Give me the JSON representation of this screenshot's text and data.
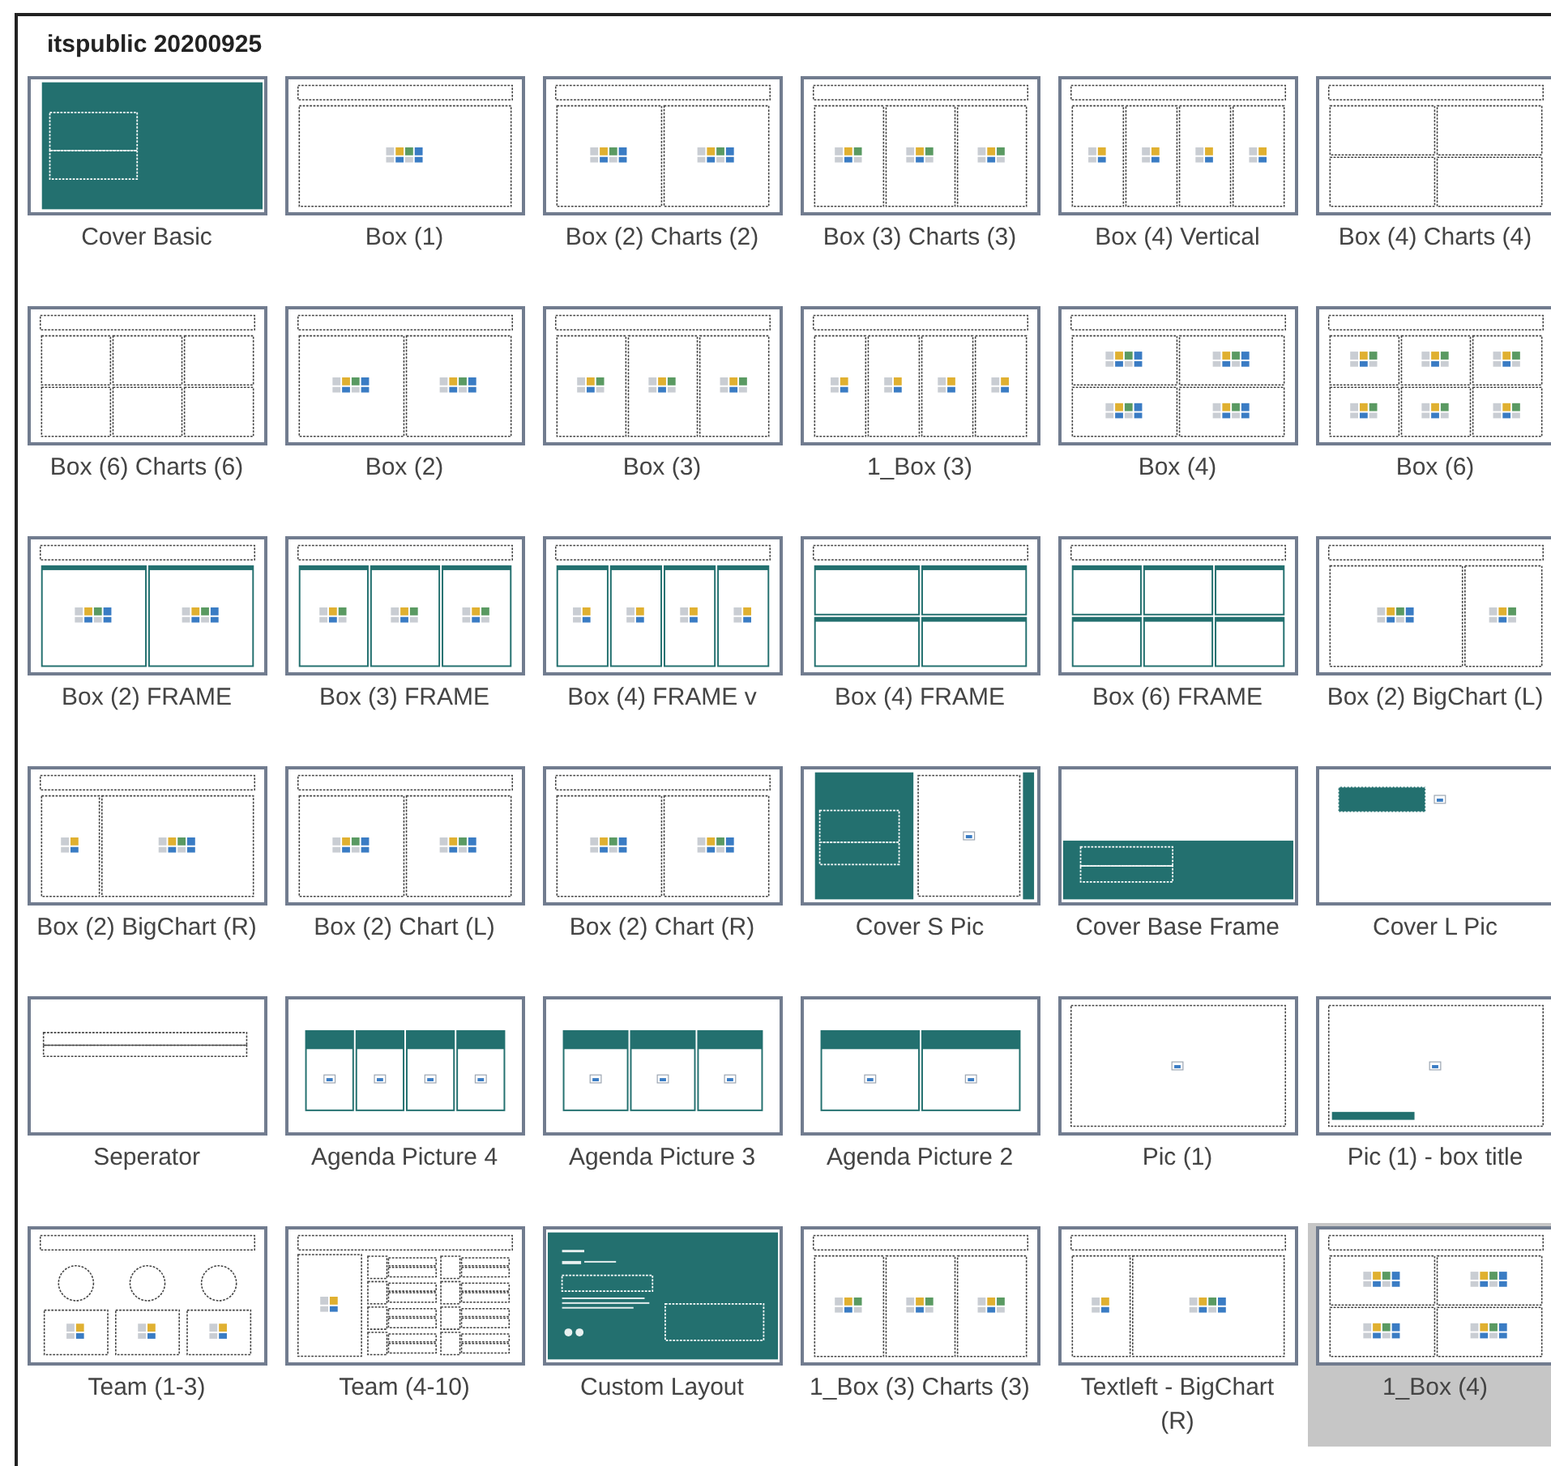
{
  "gallery": {
    "title": "itspublic 20200925"
  },
  "layouts": [
    {
      "label": "Cover Basic",
      "selected": false,
      "kind": "cover"
    },
    {
      "label": "Box (1)",
      "selected": false,
      "kind": "box1"
    },
    {
      "label": "Box (2) Charts (2)",
      "selected": false,
      "kind": "box2"
    },
    {
      "label": "Box (3) Charts (3)",
      "selected": false,
      "kind": "box3"
    },
    {
      "label": "Box (4) Vertical",
      "selected": false,
      "kind": "box4"
    },
    {
      "label": "Box (4) Charts (4)",
      "selected": false,
      "kind": "empty4"
    },
    {
      "label": "Box (6) Charts (6)",
      "selected": false,
      "kind": "empty6"
    },
    {
      "label": "Box (2)",
      "selected": false,
      "kind": "box2"
    },
    {
      "label": "Box (3)",
      "selected": false,
      "kind": "box3"
    },
    {
      "label": "1_Box (3)",
      "selected": false,
      "kind": "box4"
    },
    {
      "label": "Box (4)",
      "selected": false,
      "kind": "quad"
    },
    {
      "label": "Box (6)",
      "selected": false,
      "kind": "six"
    },
    {
      "label": "Box (2) FRAME",
      "selected": false,
      "kind": "frame2"
    },
    {
      "label": "Box (3) FRAME",
      "selected": false,
      "kind": "frame3"
    },
    {
      "label": "Box (4) FRAME v",
      "selected": false,
      "kind": "frame4"
    },
    {
      "label": "Box (4) FRAME",
      "selected": false,
      "kind": "framequad"
    },
    {
      "label": "Box (6) FRAME",
      "selected": false,
      "kind": "framesix"
    },
    {
      "label": "Box (2) BigChart (L)",
      "selected": false,
      "kind": "bigleft"
    },
    {
      "label": "Box (2) BigChart (R)",
      "selected": false,
      "kind": "bigright"
    },
    {
      "label": "Box (2) Chart (L)",
      "selected": false,
      "kind": "box2"
    },
    {
      "label": "Box (2) Chart (R)",
      "selected": false,
      "kind": "box2"
    },
    {
      "label": "Cover S Pic",
      "selected": false,
      "kind": "coverspic"
    },
    {
      "label": "Cover Base Frame",
      "selected": false,
      "kind": "coverframe"
    },
    {
      "label": "Cover L Pic",
      "selected": false,
      "kind": "coverlpic"
    },
    {
      "label": "Seperator",
      "selected": false,
      "kind": "separator"
    },
    {
      "label": "Agenda Picture 4",
      "selected": false,
      "kind": "agenda4"
    },
    {
      "label": "Agenda Picture 3",
      "selected": false,
      "kind": "agenda3"
    },
    {
      "label": "Agenda Picture 2",
      "selected": false,
      "kind": "agenda2"
    },
    {
      "label": "Pic (1)",
      "selected": false,
      "kind": "pic"
    },
    {
      "label": "Pic (1) - box title",
      "selected": false,
      "kind": "pictitle"
    },
    {
      "label": "Team (1-3)",
      "selected": false,
      "kind": "team"
    },
    {
      "label": "Team (4-10)",
      "selected": false,
      "kind": "teamlist"
    },
    {
      "label": "Custom Layout",
      "selected": false,
      "kind": "custom"
    },
    {
      "label": "1_Box (3) Charts (3)",
      "selected": false,
      "kind": "box3"
    },
    {
      "label": "Textleft - BigChart (R)",
      "selected": false,
      "kind": "bigright"
    },
    {
      "label": "1_Box (4)",
      "selected": true,
      "kind": "quad"
    }
  ]
}
